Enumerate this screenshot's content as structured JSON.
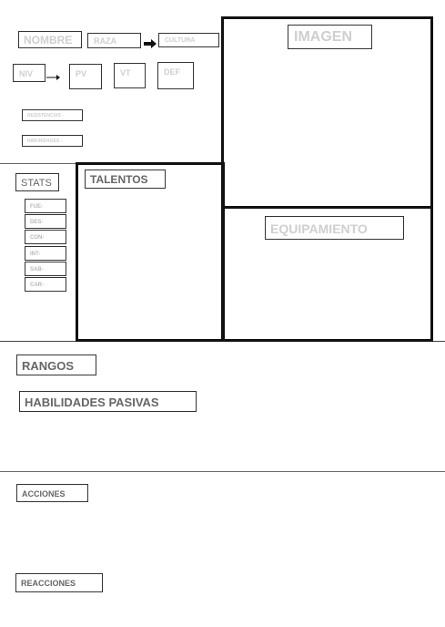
{
  "header": {
    "nombre": "NOMBRE",
    "raza": "RAZA",
    "cultura": "CULTURA",
    "niv": "NIV",
    "pv": "PV",
    "vt": "VT",
    "def": "DEF",
    "resistencias": "RESISTENCIAS -",
    "inmunidades": "INMUNIDADES -"
  },
  "imagen": {
    "title": "IMAGEN"
  },
  "equipamiento": {
    "title": "EQUIPAMIENTO"
  },
  "stats": {
    "title": "STATS",
    "items": [
      "FUE-",
      "DES-",
      "CON-",
      "INT-",
      "SAB-",
      "CAR-"
    ]
  },
  "talentos": {
    "title": "TALENTOS"
  },
  "rangos": {
    "title": "RANGOS"
  },
  "habilidades": {
    "title": "HABILIDADES PASIVAS"
  },
  "acciones": {
    "title": "ACCIONES"
  },
  "reacciones": {
    "title": "REACCIONES"
  },
  "colors": {
    "border": "#111111",
    "label_faint": "#cfcfcf",
    "label_dark": "#666666"
  }
}
